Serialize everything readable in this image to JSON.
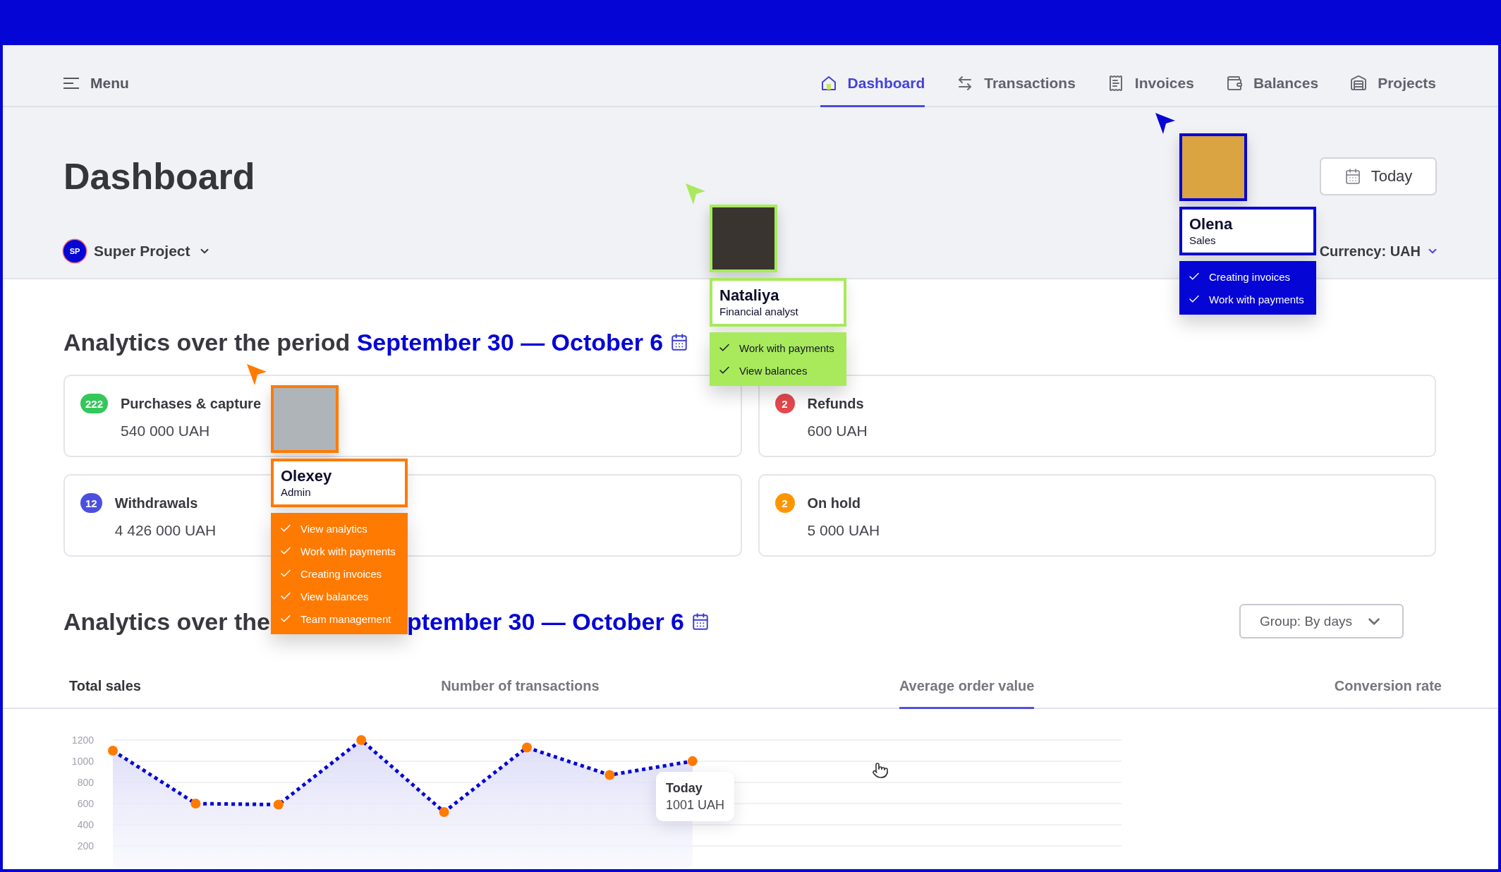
{
  "nav": {
    "menu": "Menu",
    "tabs": [
      {
        "label": "Dashboard",
        "selected": true
      },
      {
        "label": "Transactions",
        "selected": false
      },
      {
        "label": "Invoices",
        "selected": false
      },
      {
        "label": "Balances",
        "selected": false
      },
      {
        "label": "Projects",
        "selected": false
      }
    ]
  },
  "header": {
    "title": "Dashboard",
    "today_button": "Today",
    "project": {
      "initials": "SP",
      "name": "Super Project"
    },
    "currency": "Currency: UAH"
  },
  "summary": {
    "title": "Analytics over the period",
    "period": "September 30 — October 6",
    "stats": [
      {
        "badge": "222",
        "color": "#34c759",
        "label": "Purchases & capture",
        "value": "540 000 UAH"
      },
      {
        "badge": "2",
        "color": "#e5484d",
        "label": "Refunds",
        "value": "600 UAH"
      },
      {
        "badge": "12",
        "color": "#4b4fe0",
        "label": "Withdrawals",
        "value": "4 426 000 UAH"
      },
      {
        "badge": "2",
        "color": "#ff9500",
        "label": "On hold",
        "value": "5 000 UAH"
      }
    ]
  },
  "sales": {
    "title": "Analytics over the",
    "period": "ptember 30 — October 6",
    "group_select": "Group: By days",
    "tabs": [
      {
        "label": "Total sales",
        "selected": false,
        "highlighted": true
      },
      {
        "label": "Number of transactions",
        "selected": false,
        "highlighted": false
      },
      {
        "label": "Average order value",
        "selected": true,
        "highlighted": false
      },
      {
        "label": "Conversion rate",
        "selected": false,
        "highlighted": false
      }
    ],
    "chart_data": {
      "type": "area",
      "grid": true,
      "ylim": [
        0,
        1200
      ],
      "yticks": [
        200,
        400,
        600,
        800,
        1000,
        1200
      ],
      "values": [
        1100,
        600,
        590,
        1200,
        520,
        1130,
        870,
        1001
      ]
    },
    "tooltip": {
      "title": "Today",
      "value": "1001 UAH"
    }
  },
  "collaborators": [
    {
      "name": "Olena",
      "role": "Sales",
      "color": "#0505d6",
      "permissions": [
        "Creating invoices",
        "Work with payments"
      ]
    },
    {
      "name": "Nataliya",
      "role": "Financial analyst",
      "color": "#a8ea5c",
      "permissions": [
        "Work with payments",
        "View balances"
      ]
    },
    {
      "name": "Olexey",
      "role": "Admin",
      "color": "#ff7a00",
      "permissions": [
        "View analytics",
        "Work with payments",
        "Creating invoices",
        "View balances",
        "Team management"
      ]
    }
  ]
}
